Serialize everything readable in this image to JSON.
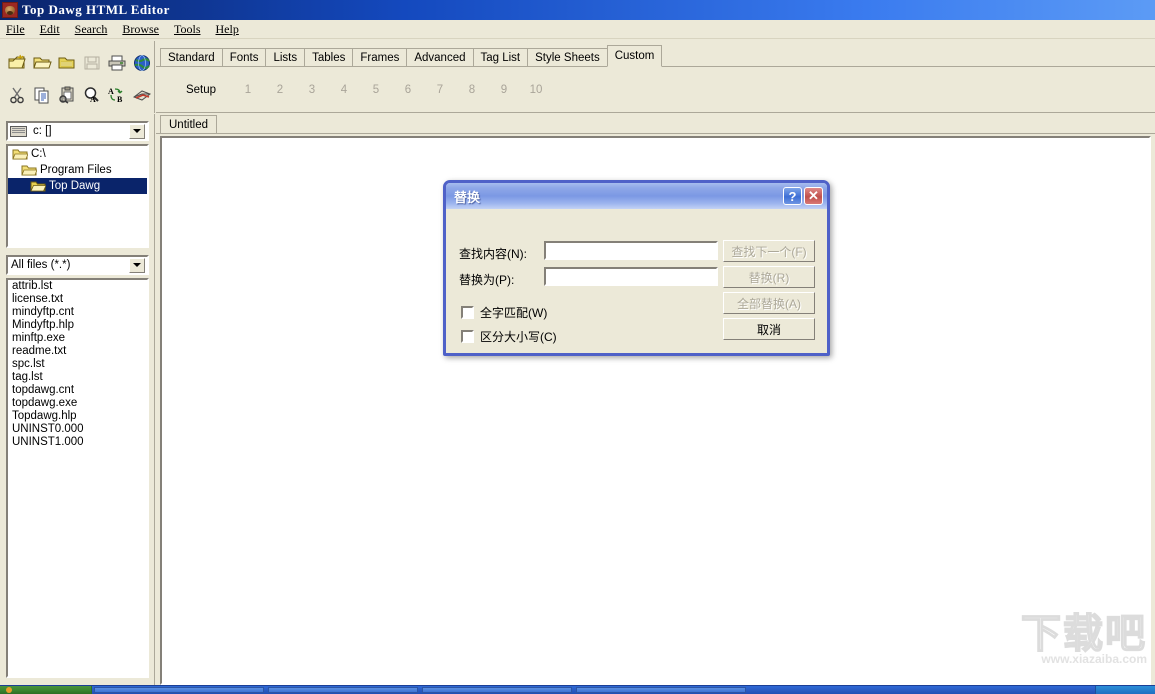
{
  "window": {
    "title": "Top Dawg HTML Editor",
    "icon": "dog-icon"
  },
  "menubar": {
    "items": [
      {
        "label": "File"
      },
      {
        "label": "Edit"
      },
      {
        "label": "Search"
      },
      {
        "label": "Browse"
      },
      {
        "label": "Tools"
      },
      {
        "label": "Help"
      }
    ]
  },
  "toolbar": {
    "row1": [
      {
        "name": "new-file-icon"
      },
      {
        "name": "open-folder-icon"
      },
      {
        "name": "folder-icon"
      },
      {
        "name": "save-icon"
      },
      {
        "name": "print-icon"
      },
      {
        "name": "browse-globe-icon"
      }
    ],
    "row2": [
      {
        "name": "cut-icon"
      },
      {
        "name": "copy-icon"
      },
      {
        "name": "paste-icon"
      },
      {
        "name": "find-icon"
      },
      {
        "name": "replace-icon"
      },
      {
        "name": "spellcheck-icon"
      }
    ]
  },
  "tabs": [
    {
      "label": "Standard",
      "active": false
    },
    {
      "label": "Fonts",
      "active": false
    },
    {
      "label": "Lists",
      "active": false
    },
    {
      "label": "Tables",
      "active": false
    },
    {
      "label": "Frames",
      "active": false
    },
    {
      "label": "Advanced",
      "active": false
    },
    {
      "label": "Tag List",
      "active": false
    },
    {
      "label": "Style Sheets",
      "active": false
    },
    {
      "label": "Custom",
      "active": true
    }
  ],
  "custom_toolbar": {
    "setup_label": "Setup",
    "slots": [
      "1",
      "2",
      "3",
      "4",
      "5",
      "6",
      "7",
      "8",
      "9",
      "10"
    ]
  },
  "document": {
    "tab_label": "Untitled",
    "content": ""
  },
  "file_panel": {
    "drive": {
      "value": "c: []",
      "icon": "drive-icon"
    },
    "tree": [
      {
        "label": "C:\\",
        "level": 0,
        "selected": false
      },
      {
        "label": "Program Files",
        "level": 1,
        "selected": false
      },
      {
        "label": "Top Dawg",
        "level": 2,
        "selected": true
      }
    ],
    "filter": {
      "value": "All files (*.*)"
    },
    "files": [
      "attrib.lst",
      "license.txt",
      "mindyftp.cnt",
      "Mindyftp.hlp",
      "minftp.exe",
      "readme.txt",
      "spc.lst",
      "tag.lst",
      "topdawg.cnt",
      "topdawg.exe",
      "Topdawg.hlp",
      "UNINST0.000",
      "UNINST1.000"
    ]
  },
  "dialog": {
    "title": "替换",
    "help_button": "?",
    "close_button": "✕",
    "find_label": "查找内容(N):",
    "find_value": "",
    "replace_label": "替换为(P):",
    "replace_value": "",
    "checkboxes": [
      {
        "label": "全字匹配(W)",
        "checked": false
      },
      {
        "label": "区分大小写(C)",
        "checked": false
      }
    ],
    "buttons": [
      {
        "label": "查找下一个(F)",
        "disabled": true
      },
      {
        "label": "替换(R)",
        "disabled": true
      },
      {
        "label": "全部替换(A)",
        "disabled": true
      },
      {
        "label": "取消",
        "disabled": false
      }
    ]
  },
  "watermark": {
    "chars": "下载吧",
    "url": "www.xiazaiba.com"
  },
  "colors": {
    "titlebar_blue": "#1449BE",
    "face": "#ECE9D8",
    "dialog_border": "#4F61C8",
    "selection": "#0A246A",
    "disabled_text": "#ACA899"
  }
}
